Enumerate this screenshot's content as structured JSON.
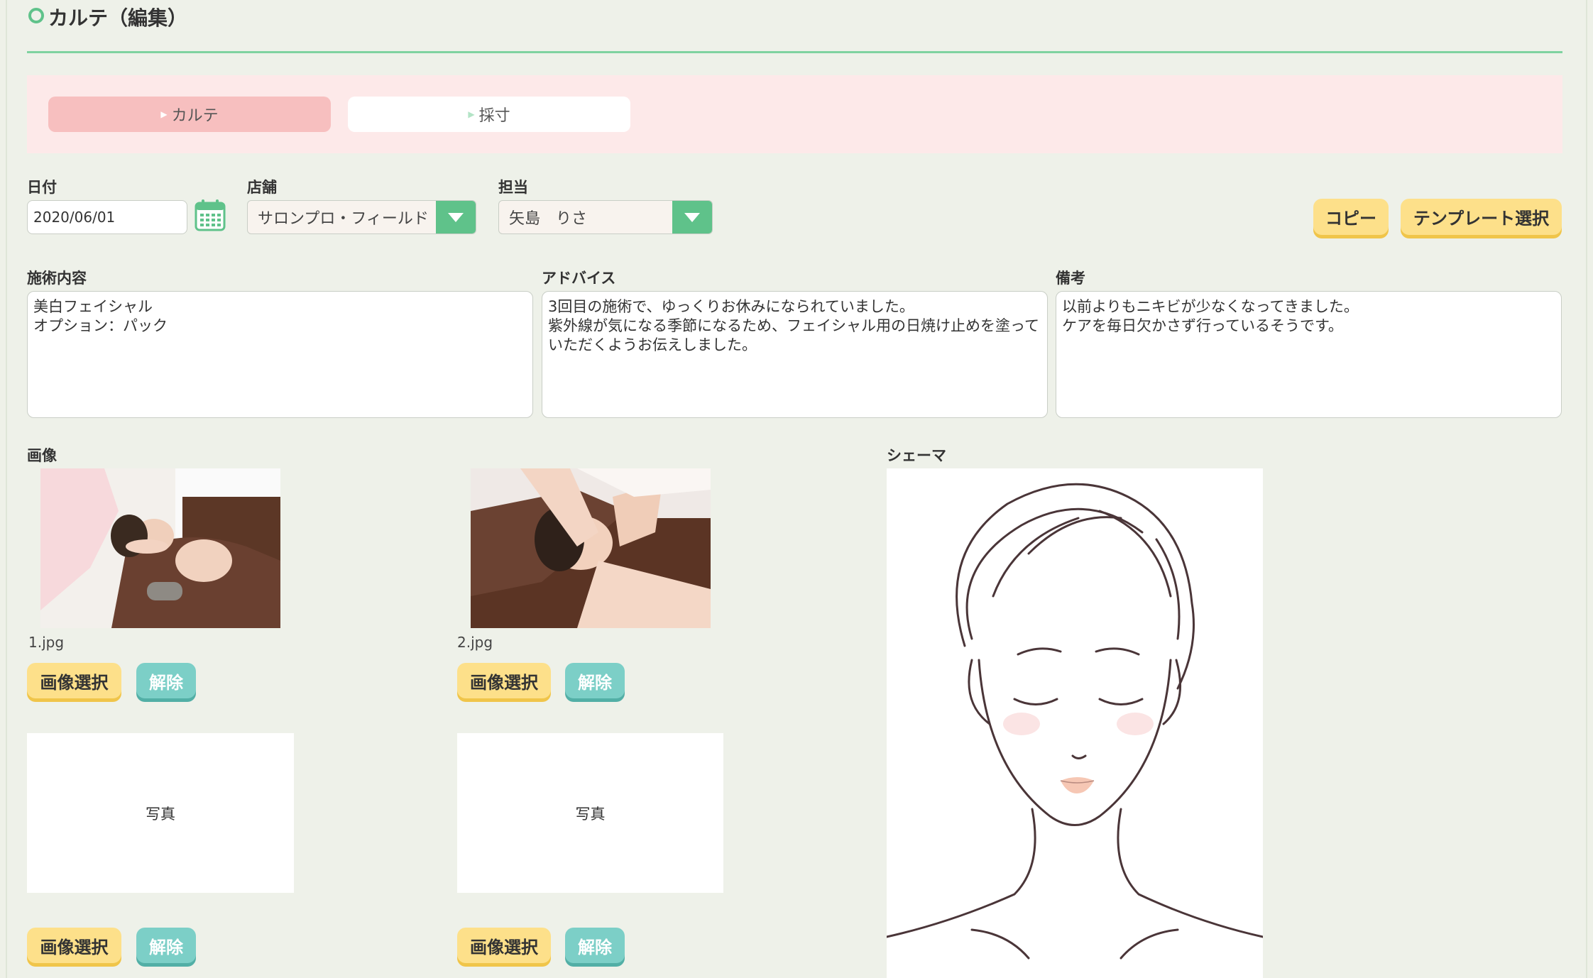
{
  "page": {
    "title": "カルテ（編集）"
  },
  "tabs": [
    {
      "label": "カルテ",
      "active": true
    },
    {
      "label": "採寸",
      "active": false
    }
  ],
  "form": {
    "date": {
      "label": "日付",
      "value": "2020/06/01"
    },
    "store": {
      "label": "店舗",
      "value": "サロンプロ・フィールド"
    },
    "staff": {
      "label": "担当",
      "value": "矢島　りさ"
    },
    "copy_button": "コピー",
    "template_button": "テンプレート選択"
  },
  "notes": {
    "treatment": {
      "label": "施術内容",
      "value": "美白フェイシャル\nオプション：パック"
    },
    "advice": {
      "label": "アドバイス",
      "value": "3回目の施術で、ゆっくりお休みになられていました。\n紫外線が気になる季節になるため、フェイシャル用の日焼け止めを塗っていただくようお伝えしました。"
    },
    "remarks": {
      "label": "備考",
      "value": "以前よりもニキビが少なくなってきました。\nケアを毎日欠かさず行っているそうです。"
    }
  },
  "images": {
    "label": "画像",
    "slots": [
      {
        "filename": "1.jpg",
        "select": "画像選択",
        "clear": "解除"
      },
      {
        "filename": "2.jpg",
        "select": "画像選択",
        "clear": "解除"
      },
      {
        "placeholder": "写真",
        "select": "画像選択",
        "clear": "解除"
      },
      {
        "placeholder": "写真",
        "select": "画像選択",
        "clear": "解除"
      }
    ]
  },
  "schema": {
    "label": "シェーマ"
  },
  "colors": {
    "accent_green": "#5fc28a",
    "tab_active": "#f7bfbf",
    "tabs_bg": "#fde9e9",
    "button_yellow": "#fde08a",
    "button_teal": "#7ccfc7"
  }
}
